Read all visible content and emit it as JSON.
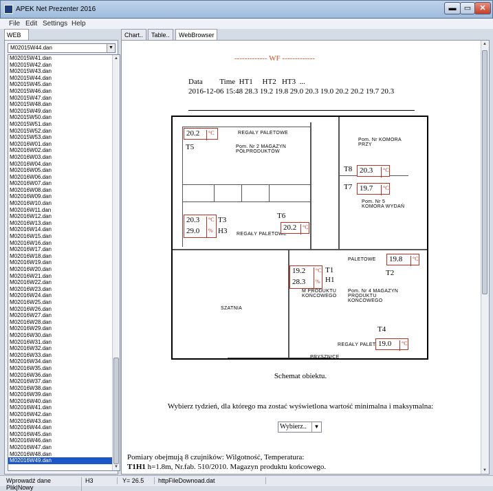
{
  "window": {
    "title": "APEK Net Prezenter 2016",
    "min": "▬",
    "max": "▭",
    "close": "✕"
  },
  "menu": [
    "File",
    "Edit",
    "Settings",
    "Help"
  ],
  "left_tab": "WEB",
  "combo_value": "M02015W44.dan",
  "files": [
    "M02015W41.dan",
    "M02015W42.dan",
    "M02015W43.dan",
    "M02015W44.dan",
    "M02015W45.dan",
    "M02015W46.dan",
    "M02015W47.dan",
    "M02015W48.dan",
    "M02015W49.dan",
    "M02015W50.dan",
    "M02015W51.dan",
    "M02015W52.dan",
    "M02015W53.dan",
    "M02016W01.dan",
    "M02016W02.dan",
    "M02016W03.dan",
    "M02016W04.dan",
    "M02016W05.dan",
    "M02016W06.dan",
    "M02016W07.dan",
    "M02016W08.dan",
    "M02016W09.dan",
    "M02016W10.dan",
    "M02016W11.dan",
    "M02016W12.dan",
    "M02016W13.dan",
    "M02016W14.dan",
    "M02016W15.dan",
    "M02016W16.dan",
    "M02016W17.dan",
    "M02016W18.dan",
    "M02016W19.dan",
    "M02016W20.dan",
    "M02016W21.dan",
    "M02016W22.dan",
    "M02016W23.dan",
    "M02016W24.dan",
    "M02016W25.dan",
    "M02016W26.dan",
    "M02016W27.dan",
    "M02016W28.dan",
    "M02016W29.dan",
    "M02016W30.dan",
    "M02016W31.dan",
    "M02016W32.dan",
    "M02016W33.dan",
    "M02016W34.dan",
    "M02016W35.dan",
    "M02016W36.dan",
    "M02016W37.dan",
    "M02016W38.dan",
    "M02016W39.dan",
    "M02016W40.dan",
    "M02016W41.dan",
    "M02016W42.dan",
    "M02016W43.dan",
    "M02016W44.dan",
    "M02016W45.dan",
    "M02016W46.dan",
    "M02016W47.dan",
    "M02016W48.dan",
    "M02016W49.dan"
  ],
  "selected_file": "M02016W49.dan",
  "right_tabs": [
    "Chart..",
    "Table..",
    "WebBrowser"
  ],
  "header": "------------- WF -------------",
  "data_labels": "Data         Time  HT1     HT2   HT3  ...",
  "data_values": "2016-12-06 15:48 28.3 19.2 19.8 29.0 20.3 19.0 20.2 20.2 19.7 20.3",
  "unit_c": "°C",
  "unit_pct": "%",
  "sensors": {
    "t5": "20.2",
    "t3t": "20.3",
    "h3": "29.0",
    "t6": "20.2",
    "t8": "20.3",
    "t7": "19.7",
    "t1": "19.2",
    "h1": "28.3",
    "t2": "19.8",
    "t4": "19.0"
  },
  "sensor_labels": {
    "t5": "T5",
    "t3": "T3",
    "h3": "H3",
    "t6": "T6",
    "t8": "T8",
    "t7": "T7",
    "t1": "T1",
    "h1": "H1",
    "t2": "T2",
    "t4": "T4"
  },
  "room_texts": {
    "regaly1": "REGAŁY PALETOWE",
    "regaly2": "REGAŁY PALETOWE",
    "regaly3": "PALETOWE",
    "regaly4": "REGAŁY PALETOWE",
    "mag2": "Pom. Nr 2 MAGAZYN PÓŁPRODUKTÓW",
    "komora1": "Pom. Nr KOMORA PRZY",
    "komora5": "Pom. Nr 5 KOMORA WYDAŃ",
    "szatnia": "SZATNIA",
    "mag4": "Pom. Nr 4 MAGAZYN PRODUKTU KOŃCOWEGO",
    "mprodukt": "M PRODUKTU KOŃCOWEGO",
    "prysznic": "PRYSZNICE"
  },
  "caption": "Schemat obiektu.",
  "week_prompt": "Wybierz tydzień, dla którego ma zostać wyświetlona wartość minimalna i maksymalna:",
  "week_select": "Wybierz..",
  "info1": "Pomiary obejmują 8 czujników: Wilgotność, Temperatura:",
  "info2_bold": "T1H1",
  "info2_rest": " h=1.8m, Nr.fab. 510/2010. Magazyn produktu końcowego.",
  "status": {
    "input": "Wprowadź dane Plik|Nowy",
    "cell": "H3",
    "y": "Y= 26.5",
    "file": "httpFileDownoad.dat"
  }
}
